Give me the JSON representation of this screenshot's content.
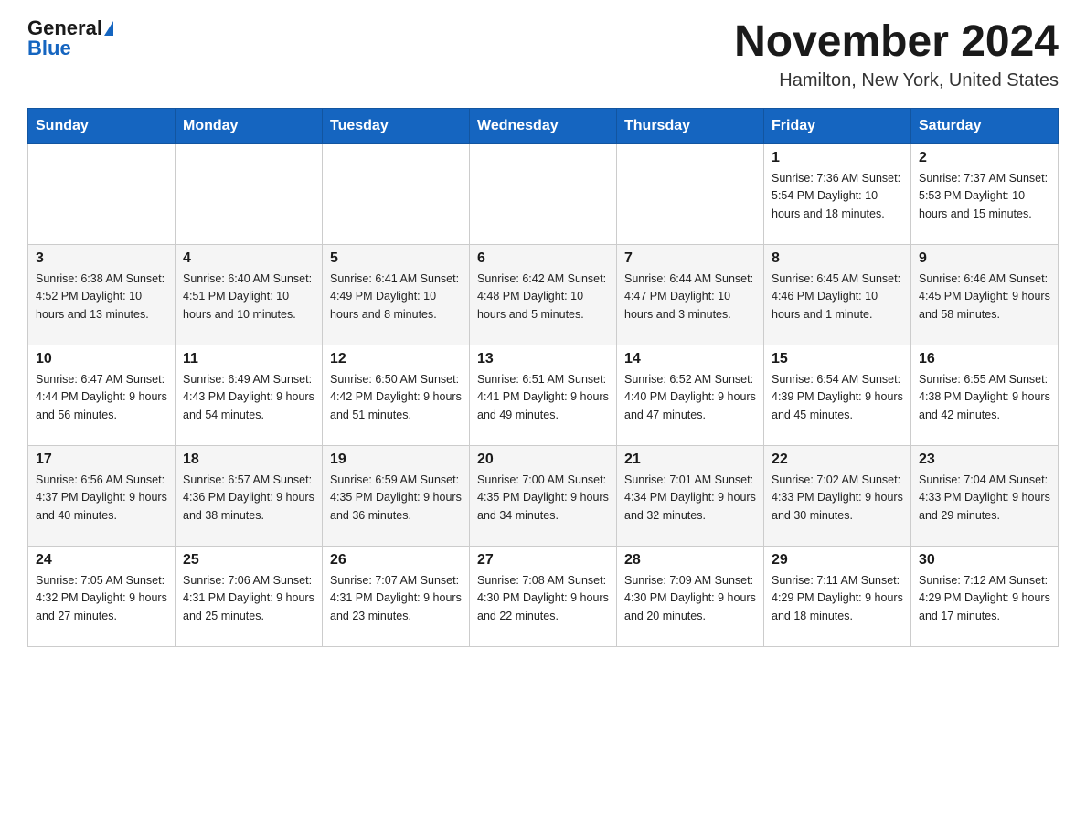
{
  "logo": {
    "general": "General",
    "blue": "Blue"
  },
  "header": {
    "month": "November 2024",
    "location": "Hamilton, New York, United States"
  },
  "weekdays": [
    "Sunday",
    "Monday",
    "Tuesday",
    "Wednesday",
    "Thursday",
    "Friday",
    "Saturday"
  ],
  "weeks": [
    [
      {
        "day": "",
        "info": ""
      },
      {
        "day": "",
        "info": ""
      },
      {
        "day": "",
        "info": ""
      },
      {
        "day": "",
        "info": ""
      },
      {
        "day": "",
        "info": ""
      },
      {
        "day": "1",
        "info": "Sunrise: 7:36 AM\nSunset: 5:54 PM\nDaylight: 10 hours\nand 18 minutes."
      },
      {
        "day": "2",
        "info": "Sunrise: 7:37 AM\nSunset: 5:53 PM\nDaylight: 10 hours\nand 15 minutes."
      }
    ],
    [
      {
        "day": "3",
        "info": "Sunrise: 6:38 AM\nSunset: 4:52 PM\nDaylight: 10 hours\nand 13 minutes."
      },
      {
        "day": "4",
        "info": "Sunrise: 6:40 AM\nSunset: 4:51 PM\nDaylight: 10 hours\nand 10 minutes."
      },
      {
        "day": "5",
        "info": "Sunrise: 6:41 AM\nSunset: 4:49 PM\nDaylight: 10 hours\nand 8 minutes."
      },
      {
        "day": "6",
        "info": "Sunrise: 6:42 AM\nSunset: 4:48 PM\nDaylight: 10 hours\nand 5 minutes."
      },
      {
        "day": "7",
        "info": "Sunrise: 6:44 AM\nSunset: 4:47 PM\nDaylight: 10 hours\nand 3 minutes."
      },
      {
        "day": "8",
        "info": "Sunrise: 6:45 AM\nSunset: 4:46 PM\nDaylight: 10 hours\nand 1 minute."
      },
      {
        "day": "9",
        "info": "Sunrise: 6:46 AM\nSunset: 4:45 PM\nDaylight: 9 hours\nand 58 minutes."
      }
    ],
    [
      {
        "day": "10",
        "info": "Sunrise: 6:47 AM\nSunset: 4:44 PM\nDaylight: 9 hours\nand 56 minutes."
      },
      {
        "day": "11",
        "info": "Sunrise: 6:49 AM\nSunset: 4:43 PM\nDaylight: 9 hours\nand 54 minutes."
      },
      {
        "day": "12",
        "info": "Sunrise: 6:50 AM\nSunset: 4:42 PM\nDaylight: 9 hours\nand 51 minutes."
      },
      {
        "day": "13",
        "info": "Sunrise: 6:51 AM\nSunset: 4:41 PM\nDaylight: 9 hours\nand 49 minutes."
      },
      {
        "day": "14",
        "info": "Sunrise: 6:52 AM\nSunset: 4:40 PM\nDaylight: 9 hours\nand 47 minutes."
      },
      {
        "day": "15",
        "info": "Sunrise: 6:54 AM\nSunset: 4:39 PM\nDaylight: 9 hours\nand 45 minutes."
      },
      {
        "day": "16",
        "info": "Sunrise: 6:55 AM\nSunset: 4:38 PM\nDaylight: 9 hours\nand 42 minutes."
      }
    ],
    [
      {
        "day": "17",
        "info": "Sunrise: 6:56 AM\nSunset: 4:37 PM\nDaylight: 9 hours\nand 40 minutes."
      },
      {
        "day": "18",
        "info": "Sunrise: 6:57 AM\nSunset: 4:36 PM\nDaylight: 9 hours\nand 38 minutes."
      },
      {
        "day": "19",
        "info": "Sunrise: 6:59 AM\nSunset: 4:35 PM\nDaylight: 9 hours\nand 36 minutes."
      },
      {
        "day": "20",
        "info": "Sunrise: 7:00 AM\nSunset: 4:35 PM\nDaylight: 9 hours\nand 34 minutes."
      },
      {
        "day": "21",
        "info": "Sunrise: 7:01 AM\nSunset: 4:34 PM\nDaylight: 9 hours\nand 32 minutes."
      },
      {
        "day": "22",
        "info": "Sunrise: 7:02 AM\nSunset: 4:33 PM\nDaylight: 9 hours\nand 30 minutes."
      },
      {
        "day": "23",
        "info": "Sunrise: 7:04 AM\nSunset: 4:33 PM\nDaylight: 9 hours\nand 29 minutes."
      }
    ],
    [
      {
        "day": "24",
        "info": "Sunrise: 7:05 AM\nSunset: 4:32 PM\nDaylight: 9 hours\nand 27 minutes."
      },
      {
        "day": "25",
        "info": "Sunrise: 7:06 AM\nSunset: 4:31 PM\nDaylight: 9 hours\nand 25 minutes."
      },
      {
        "day": "26",
        "info": "Sunrise: 7:07 AM\nSunset: 4:31 PM\nDaylight: 9 hours\nand 23 minutes."
      },
      {
        "day": "27",
        "info": "Sunrise: 7:08 AM\nSunset: 4:30 PM\nDaylight: 9 hours\nand 22 minutes."
      },
      {
        "day": "28",
        "info": "Sunrise: 7:09 AM\nSunset: 4:30 PM\nDaylight: 9 hours\nand 20 minutes."
      },
      {
        "day": "29",
        "info": "Sunrise: 7:11 AM\nSunset: 4:29 PM\nDaylight: 9 hours\nand 18 minutes."
      },
      {
        "day": "30",
        "info": "Sunrise: 7:12 AM\nSunset: 4:29 PM\nDaylight: 9 hours\nand 17 minutes."
      }
    ]
  ]
}
